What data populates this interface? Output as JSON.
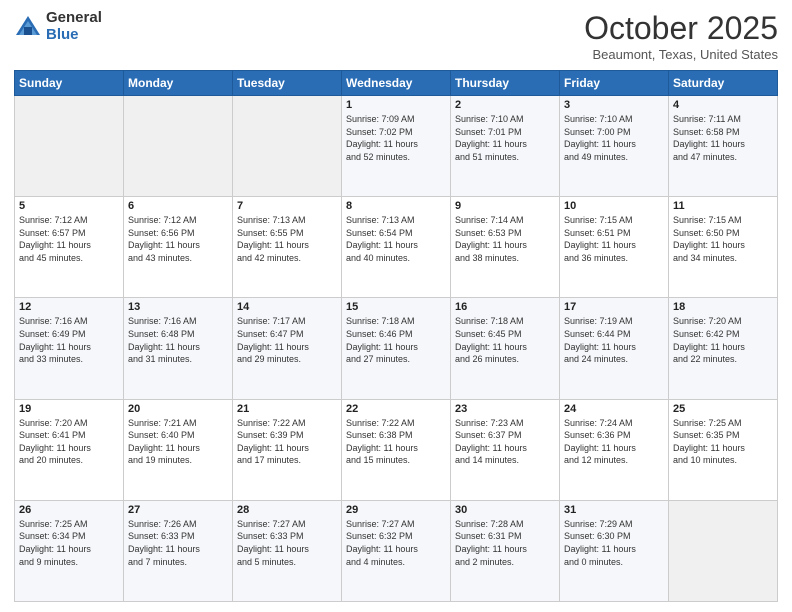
{
  "logo": {
    "general": "General",
    "blue": "Blue"
  },
  "header": {
    "month": "October 2025",
    "location": "Beaumont, Texas, United States"
  },
  "weekdays": [
    "Sunday",
    "Monday",
    "Tuesday",
    "Wednesday",
    "Thursday",
    "Friday",
    "Saturday"
  ],
  "weeks": [
    [
      {
        "day": "",
        "info": ""
      },
      {
        "day": "",
        "info": ""
      },
      {
        "day": "",
        "info": ""
      },
      {
        "day": "1",
        "info": "Sunrise: 7:09 AM\nSunset: 7:02 PM\nDaylight: 11 hours\nand 52 minutes."
      },
      {
        "day": "2",
        "info": "Sunrise: 7:10 AM\nSunset: 7:01 PM\nDaylight: 11 hours\nand 51 minutes."
      },
      {
        "day": "3",
        "info": "Sunrise: 7:10 AM\nSunset: 7:00 PM\nDaylight: 11 hours\nand 49 minutes."
      },
      {
        "day": "4",
        "info": "Sunrise: 7:11 AM\nSunset: 6:58 PM\nDaylight: 11 hours\nand 47 minutes."
      }
    ],
    [
      {
        "day": "5",
        "info": "Sunrise: 7:12 AM\nSunset: 6:57 PM\nDaylight: 11 hours\nand 45 minutes."
      },
      {
        "day": "6",
        "info": "Sunrise: 7:12 AM\nSunset: 6:56 PM\nDaylight: 11 hours\nand 43 minutes."
      },
      {
        "day": "7",
        "info": "Sunrise: 7:13 AM\nSunset: 6:55 PM\nDaylight: 11 hours\nand 42 minutes."
      },
      {
        "day": "8",
        "info": "Sunrise: 7:13 AM\nSunset: 6:54 PM\nDaylight: 11 hours\nand 40 minutes."
      },
      {
        "day": "9",
        "info": "Sunrise: 7:14 AM\nSunset: 6:53 PM\nDaylight: 11 hours\nand 38 minutes."
      },
      {
        "day": "10",
        "info": "Sunrise: 7:15 AM\nSunset: 6:51 PM\nDaylight: 11 hours\nand 36 minutes."
      },
      {
        "day": "11",
        "info": "Sunrise: 7:15 AM\nSunset: 6:50 PM\nDaylight: 11 hours\nand 34 minutes."
      }
    ],
    [
      {
        "day": "12",
        "info": "Sunrise: 7:16 AM\nSunset: 6:49 PM\nDaylight: 11 hours\nand 33 minutes."
      },
      {
        "day": "13",
        "info": "Sunrise: 7:16 AM\nSunset: 6:48 PM\nDaylight: 11 hours\nand 31 minutes."
      },
      {
        "day": "14",
        "info": "Sunrise: 7:17 AM\nSunset: 6:47 PM\nDaylight: 11 hours\nand 29 minutes."
      },
      {
        "day": "15",
        "info": "Sunrise: 7:18 AM\nSunset: 6:46 PM\nDaylight: 11 hours\nand 27 minutes."
      },
      {
        "day": "16",
        "info": "Sunrise: 7:18 AM\nSunset: 6:45 PM\nDaylight: 11 hours\nand 26 minutes."
      },
      {
        "day": "17",
        "info": "Sunrise: 7:19 AM\nSunset: 6:44 PM\nDaylight: 11 hours\nand 24 minutes."
      },
      {
        "day": "18",
        "info": "Sunrise: 7:20 AM\nSunset: 6:42 PM\nDaylight: 11 hours\nand 22 minutes."
      }
    ],
    [
      {
        "day": "19",
        "info": "Sunrise: 7:20 AM\nSunset: 6:41 PM\nDaylight: 11 hours\nand 20 minutes."
      },
      {
        "day": "20",
        "info": "Sunrise: 7:21 AM\nSunset: 6:40 PM\nDaylight: 11 hours\nand 19 minutes."
      },
      {
        "day": "21",
        "info": "Sunrise: 7:22 AM\nSunset: 6:39 PM\nDaylight: 11 hours\nand 17 minutes."
      },
      {
        "day": "22",
        "info": "Sunrise: 7:22 AM\nSunset: 6:38 PM\nDaylight: 11 hours\nand 15 minutes."
      },
      {
        "day": "23",
        "info": "Sunrise: 7:23 AM\nSunset: 6:37 PM\nDaylight: 11 hours\nand 14 minutes."
      },
      {
        "day": "24",
        "info": "Sunrise: 7:24 AM\nSunset: 6:36 PM\nDaylight: 11 hours\nand 12 minutes."
      },
      {
        "day": "25",
        "info": "Sunrise: 7:25 AM\nSunset: 6:35 PM\nDaylight: 11 hours\nand 10 minutes."
      }
    ],
    [
      {
        "day": "26",
        "info": "Sunrise: 7:25 AM\nSunset: 6:34 PM\nDaylight: 11 hours\nand 9 minutes."
      },
      {
        "day": "27",
        "info": "Sunrise: 7:26 AM\nSunset: 6:33 PM\nDaylight: 11 hours\nand 7 minutes."
      },
      {
        "day": "28",
        "info": "Sunrise: 7:27 AM\nSunset: 6:33 PM\nDaylight: 11 hours\nand 5 minutes."
      },
      {
        "day": "29",
        "info": "Sunrise: 7:27 AM\nSunset: 6:32 PM\nDaylight: 11 hours\nand 4 minutes."
      },
      {
        "day": "30",
        "info": "Sunrise: 7:28 AM\nSunset: 6:31 PM\nDaylight: 11 hours\nand 2 minutes."
      },
      {
        "day": "31",
        "info": "Sunrise: 7:29 AM\nSunset: 6:30 PM\nDaylight: 11 hours\nand 0 minutes."
      },
      {
        "day": "",
        "info": ""
      }
    ]
  ]
}
